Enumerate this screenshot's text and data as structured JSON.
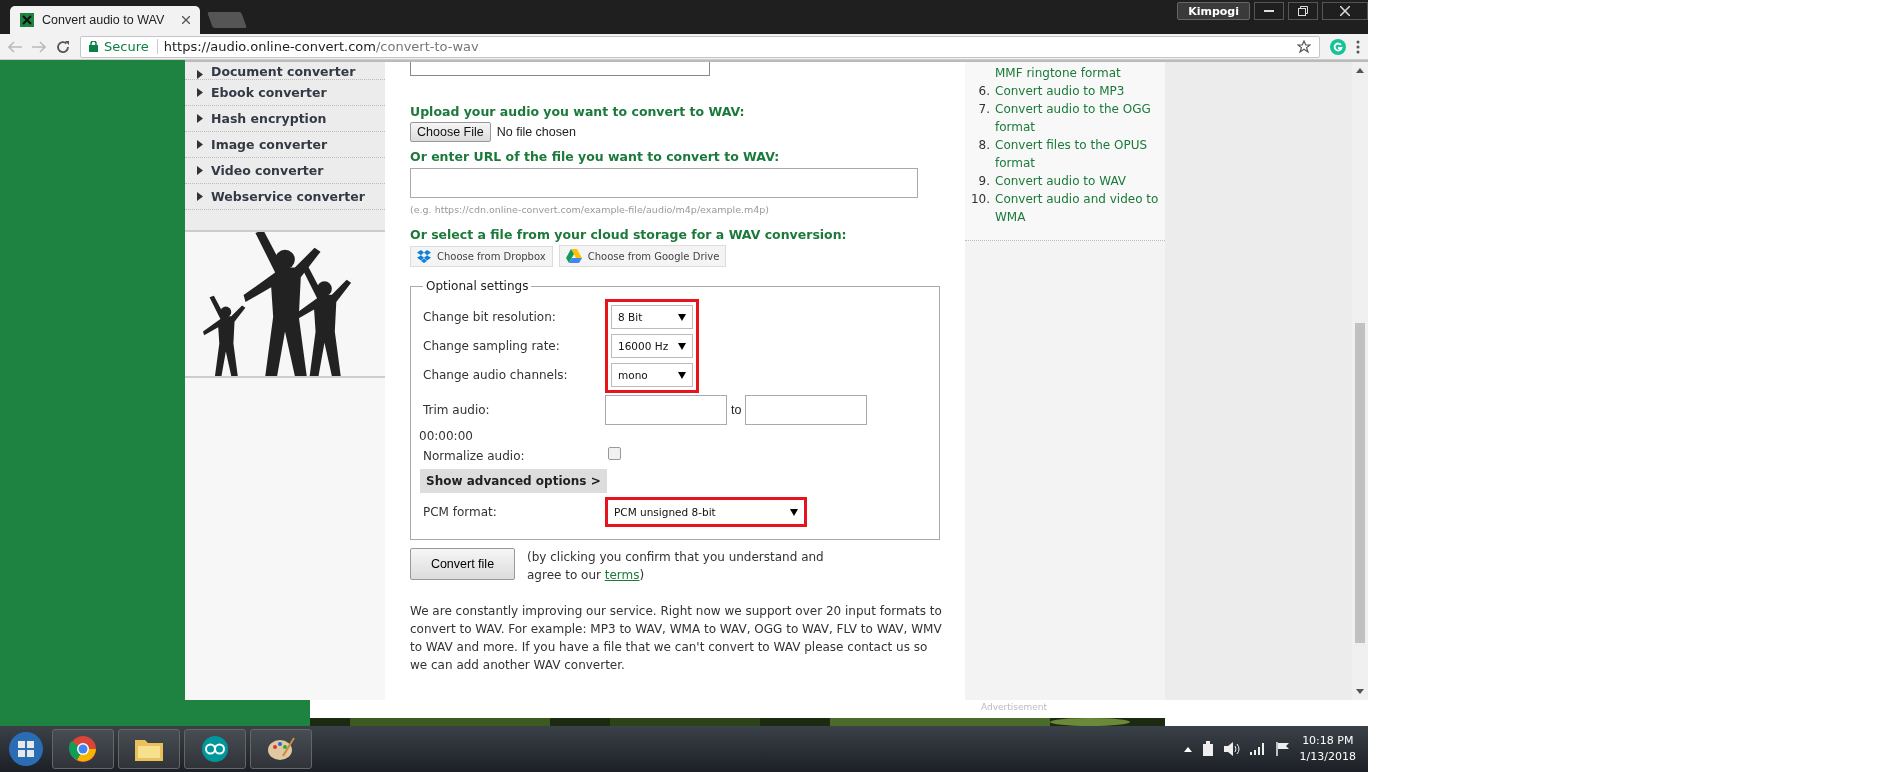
{
  "browser": {
    "tab_title": "Convert audio to WAV",
    "profile": "Kimpogi",
    "secure_label": "Secure",
    "url_host": "https://audio.online-convert.com",
    "url_path": "/convert-to-wav"
  },
  "sidebar": {
    "items": [
      {
        "label": "Document converter"
      },
      {
        "label": "Ebook converter"
      },
      {
        "label": "Hash encryption"
      },
      {
        "label": "Image converter"
      },
      {
        "label": "Video converter"
      },
      {
        "label": "Webservice converter"
      }
    ]
  },
  "form": {
    "upload_heading": "Upload your audio you want to convert to WAV:",
    "choose_file": "Choose File",
    "no_file": "No file chosen",
    "url_heading": "Or enter URL of the file you want to convert to WAV:",
    "url_example": "(e.g. https://cdn.online-convert.com/example-file/audio/m4p/example.m4p)",
    "cloud_heading": "Or select a file from your cloud storage for a WAV conversion:",
    "cloud_buttons": [
      {
        "kind": "dropbox",
        "label": "Choose from Dropbox"
      },
      {
        "kind": "drive",
        "label": "Choose from Google Drive"
      }
    ]
  },
  "settings": {
    "legend": "Optional settings",
    "selects": {
      "highlighted": true,
      "rows": [
        {
          "label": "Change bit resolution:",
          "value": "8 Bit"
        },
        {
          "label": "Change sampling rate:",
          "value": "16000 Hz"
        },
        {
          "label": "Change audio channels:",
          "value": "mono"
        }
      ]
    },
    "trim": {
      "label": "Trim audio:",
      "to": "to",
      "time": "00:00:00"
    },
    "normalize": {
      "label": "Normalize audio:",
      "checked": false
    },
    "advanced_button": "Show advanced options >",
    "pcm": {
      "label": "PCM format:",
      "value": "PCM unsigned 8-bit",
      "highlighted": true
    }
  },
  "convert": {
    "button": "Convert file",
    "note": "(by clicking you confirm that you understand and agree to our ",
    "link": "terms",
    "note_end": ")"
  },
  "description": "We are constantly improving our service. Right now we support over 20 input formats to convert to WAV. For example: MP3 to WAV, WMA to WAV, OGG to WAV, FLV to WAV, WMV to WAV and more. If you have a file that we can't convert to WAV please contact us so we can add another WAV converter.",
  "right_list": [
    {
      "label": "MMF ringtone format"
    },
    {
      "number": "6.",
      "label": "Convert audio to MP3"
    },
    {
      "number": "7.",
      "label": "Convert audio to the OGG format"
    },
    {
      "number": "8.",
      "label": "Convert files to the OPUS format"
    },
    {
      "number": "9.",
      "label": "Convert audio to WAV"
    },
    {
      "number": "10.",
      "label": "Convert audio and video to WMA"
    }
  ],
  "advertisement": "Advertisement",
  "taskbar": {
    "clock_time": "10:18 PM",
    "clock_date": "1/13/2018"
  }
}
